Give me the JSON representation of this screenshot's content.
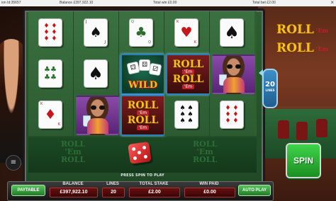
{
  "topbar": {
    "session_id": "ion Id:35657",
    "balance_text": "Balance £397,922.10",
    "total_win_text": "Total win £0.00",
    "total_bet_text": "Total bet £2.00",
    "close_symbol": "×"
  },
  "brand_logo": {
    "line1": "ROLL",
    "em": "'Em",
    "line2": "ROLL",
    "em2": "'Em"
  },
  "reels": [
    [
      {
        "type": "die",
        "color": "red",
        "pips": "♦ ♦\n♦ ♦\n♦ ♦",
        "corner": "6"
      },
      {
        "type": "die",
        "color": "green",
        "pips": "♣♣\n♣♣",
        "corner": "9"
      },
      {
        "type": "die",
        "color": "red",
        "pips": "♦",
        "corner": "K"
      }
    ],
    [
      {
        "type": "die",
        "color": "black",
        "pips": "♠",
        "corner": "J"
      },
      {
        "type": "spade",
        "pips": "♠"
      },
      {
        "type": "face"
      }
    ],
    [
      {
        "type": "die",
        "color": "green",
        "pips": "♣",
        "corner": "Q"
      },
      {
        "type": "wild",
        "label": "WILD"
      },
      {
        "type": "logo",
        "line1": "ROLL",
        "line2": "'Em",
        "line3": "ROLL",
        "line4": "'Em"
      }
    ],
    [
      {
        "type": "die",
        "color": "red",
        "pips": "♥",
        "corner": "K"
      },
      {
        "type": "logo",
        "line1": "ROLL",
        "line2": "'Em",
        "line3": "ROLL",
        "line4": "'Em"
      },
      {
        "type": "die",
        "color": "black",
        "pips": "♠ ♠\n♠ ♠\n♠ ♠",
        "corner": "8"
      }
    ],
    [
      {
        "type": "spade",
        "pips": "♠"
      },
      {
        "type": "face"
      },
      {
        "type": "die",
        "color": "red",
        "pips": "♦ ♦\n♦ ♦\n♦ ♦",
        "corner": "6"
      }
    ]
  ],
  "lines": {
    "count": "20",
    "label": "LINES"
  },
  "stage": {
    "prompt": "PRESS SPIN TO PLAY",
    "logo_left": "ROLL\n'Em\nROLL",
    "logo_right": "ROLL\n'Em\nROLL"
  },
  "controls": {
    "spin_label": "SPIN",
    "paytable_label": "PAYTABLE",
    "autoplay_label": "AUTO PLAY",
    "menu_icon": "≡"
  },
  "meters": {
    "balance_label": "BALANCE",
    "balance_value": "£397,922.10",
    "lines_label": "LINES",
    "lines_value": "20",
    "stake_label": "TOTAL STAKE",
    "stake_value": "£2.00",
    "win_label": "WIN PAID",
    "win_value": "£0.00"
  },
  "colors": {
    "felt": "#2d5d31",
    "spin": "#2fb838",
    "meter": "#6a0f0f",
    "logo_gold": "#f4c21a"
  }
}
